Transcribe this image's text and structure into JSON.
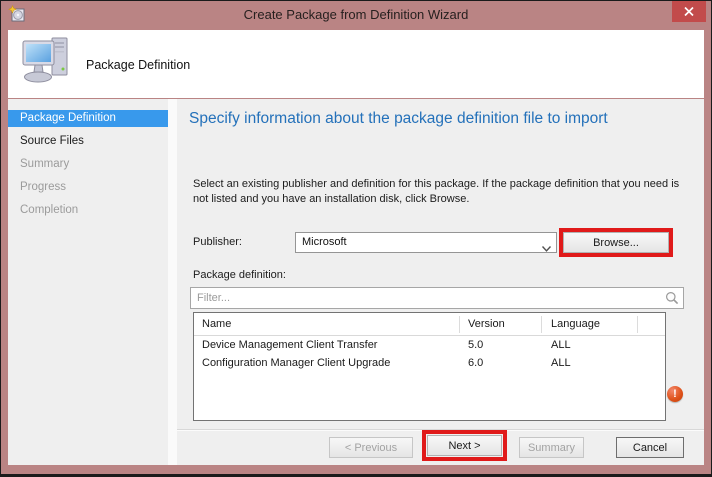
{
  "window": {
    "title": "Create Package from Definition Wizard"
  },
  "header": {
    "title": "Package Definition"
  },
  "sidebar": {
    "items": [
      {
        "label": "Package Definition",
        "state": "selected"
      },
      {
        "label": "Source Files",
        "state": "enabled"
      },
      {
        "label": "Summary",
        "state": "disabled"
      },
      {
        "label": "Progress",
        "state": "disabled"
      },
      {
        "label": "Completion",
        "state": "disabled"
      }
    ]
  },
  "main": {
    "heading": "Specify information about the package definition file to import",
    "description_lines": [
      "Select an existing publisher and definition for this package. If the package definition that you need is",
      "not listed and you have an installation disk, click Browse."
    ],
    "publisher": {
      "label": "Publisher:",
      "value": "Microsoft",
      "browse_label": "Browse..."
    },
    "package_definition": {
      "label": "Package definition:",
      "filter_placeholder": "Filter...",
      "table": {
        "columns": [
          "Name",
          "Version",
          "Language"
        ],
        "rows": [
          {
            "name": "Device Management Client Transfer",
            "version": "5.0",
            "language": "ALL"
          },
          {
            "name": "Configuration Manager Client Upgrade",
            "version": "6.0",
            "language": "ALL"
          }
        ]
      }
    },
    "error_glyph": "!"
  },
  "footer": {
    "buttons": [
      {
        "label": "< Previous",
        "enabled": false,
        "highlighted": false
      },
      {
        "label": "Next >",
        "enabled": true,
        "highlighted": true
      },
      {
        "label": "Summary",
        "enabled": false,
        "highlighted": false
      },
      {
        "label": "Cancel",
        "enabled": true,
        "highlighted": false
      }
    ]
  },
  "colors": {
    "titlebar": "#ba8484",
    "close_button": "#c24b4b",
    "selected_sidebar_item": "#3899ec",
    "heading_text": "#2471ba",
    "annotation_highlight": "#e01a1a",
    "error_icon": "#e0541d"
  }
}
